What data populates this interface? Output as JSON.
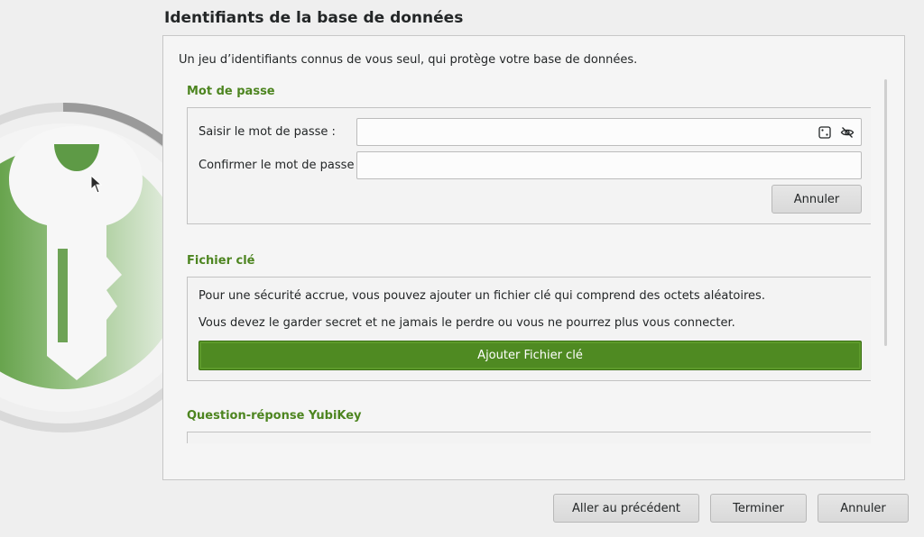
{
  "header": {
    "title": "Identifiants de la base de données"
  },
  "intro": "Un jeu d’identifiants connus de vous seul, qui protège votre base de données.",
  "password": {
    "title": "Mot de passe",
    "enter_label": "Saisir le mot de passe :",
    "confirm_label": "Confirmer le mot de passe :",
    "enter_value": "",
    "confirm_value": "",
    "generate_icon": "dice-icon",
    "toggle_icon": "eye-slash-icon",
    "cancel_label": "Annuler"
  },
  "keyfile": {
    "title": "Fichier clé",
    "line1": "Pour une sécurité accrue, vous pouvez ajouter un fichier clé qui comprend des octets aléatoires.",
    "line2": "Vous devez le garder secret et ne jamais le perdre ou vous ne pourrez plus vous connecter.",
    "add_label": "Ajouter Fichier clé"
  },
  "yubikey": {
    "title": "Question-réponse YubiKey"
  },
  "footer": {
    "back_label": "Aller au précédent",
    "finish_label": "Terminer",
    "cancel_label": "Annuler"
  },
  "colors": {
    "accent": "#4f8a22",
    "section_title": "#4d8520",
    "background": "#efefef"
  }
}
